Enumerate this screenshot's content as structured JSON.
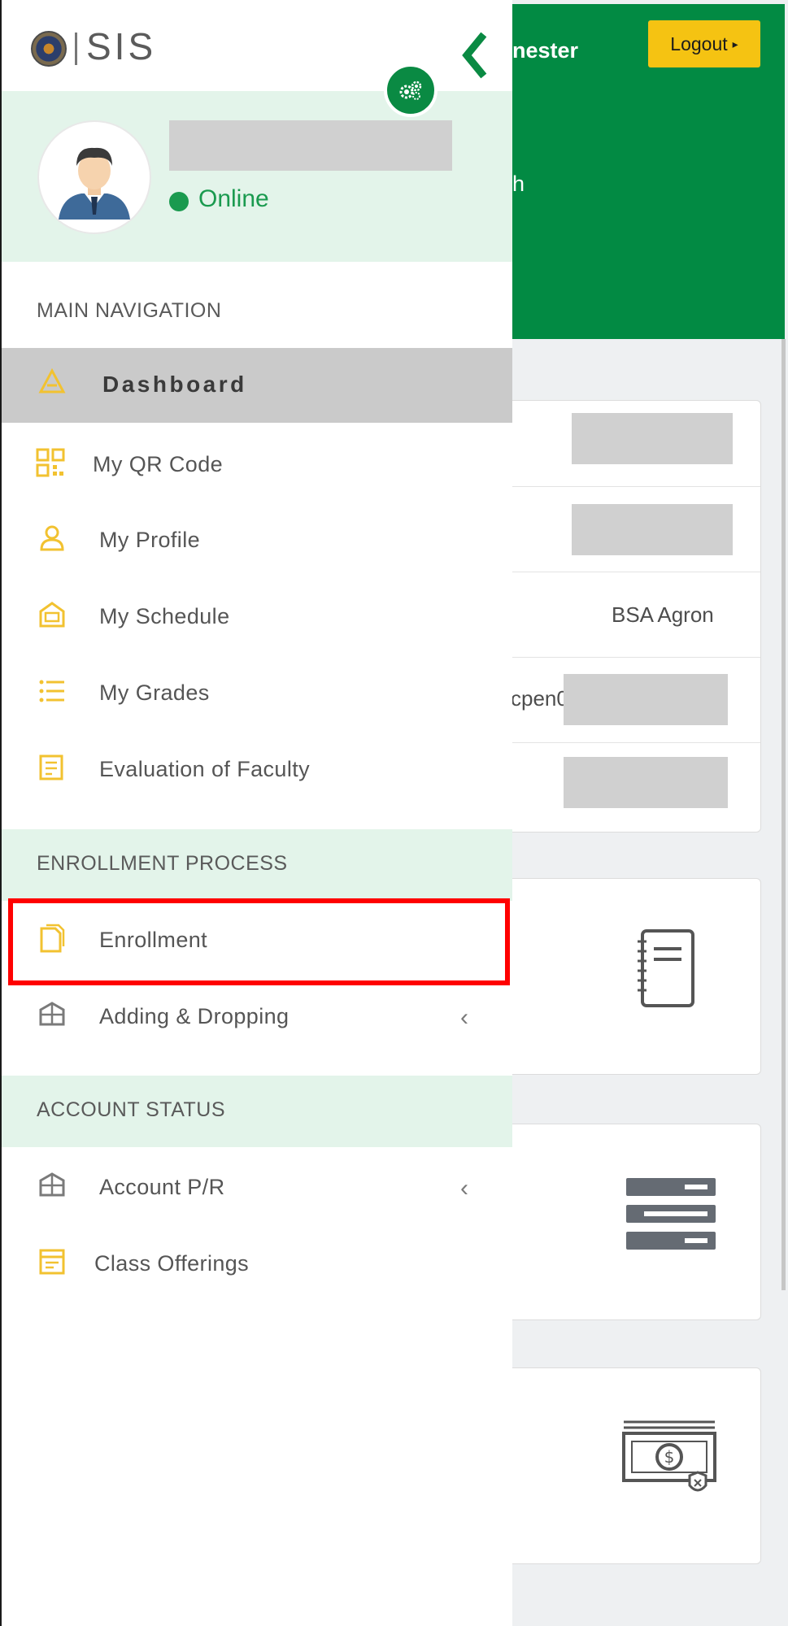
{
  "brand": {
    "app_name": "SIS"
  },
  "header": {
    "semester_fragment": "nester",
    "second_line_fragment": "h",
    "logout_label": "Logout",
    "logout_arrow": "▸"
  },
  "user": {
    "status": "Online"
  },
  "sidebar": {
    "sections": [
      {
        "title": "MAIN NAVIGATION"
      },
      {
        "title": "ENROLLMENT PROCESS"
      },
      {
        "title": "ACCOUNT STATUS"
      }
    ],
    "items": [
      {
        "label": "Dashboard",
        "icon": "dashboard-icon",
        "active": true
      },
      {
        "label": "My QR Code",
        "icon": "qr-code-icon"
      },
      {
        "label": "My Profile",
        "icon": "profile-icon"
      },
      {
        "label": "My Schedule",
        "icon": "schedule-icon"
      },
      {
        "label": "My Grades",
        "icon": "list-icon"
      },
      {
        "label": "Evaluation of Faculty",
        "icon": "evaluation-icon"
      },
      {
        "label": "Enrollment",
        "icon": "document-icon",
        "highlighted": true
      },
      {
        "label": "Adding & Dropping",
        "icon": "box-icon",
        "has_submenu": true,
        "chevron": "‹"
      },
      {
        "label": "Account P/R",
        "icon": "box-icon",
        "has_submenu": true,
        "chevron": "‹"
      },
      {
        "label": "Class Offerings",
        "icon": "calendar-icon"
      }
    ]
  },
  "info_rows": [
    {
      "text": ""
    },
    {
      "text": ""
    },
    {
      "text": "BSA Agron"
    },
    {
      "text": "cpen0"
    },
    {
      "text": ""
    }
  ],
  "colors": {
    "primary_green": "#028a43",
    "logout_yellow": "#f5c312",
    "tint_green": "#e3f4ea",
    "active_gray": "#cacaca",
    "highlight_red": "#ff0000",
    "icon_yellow": "#f2c230"
  }
}
